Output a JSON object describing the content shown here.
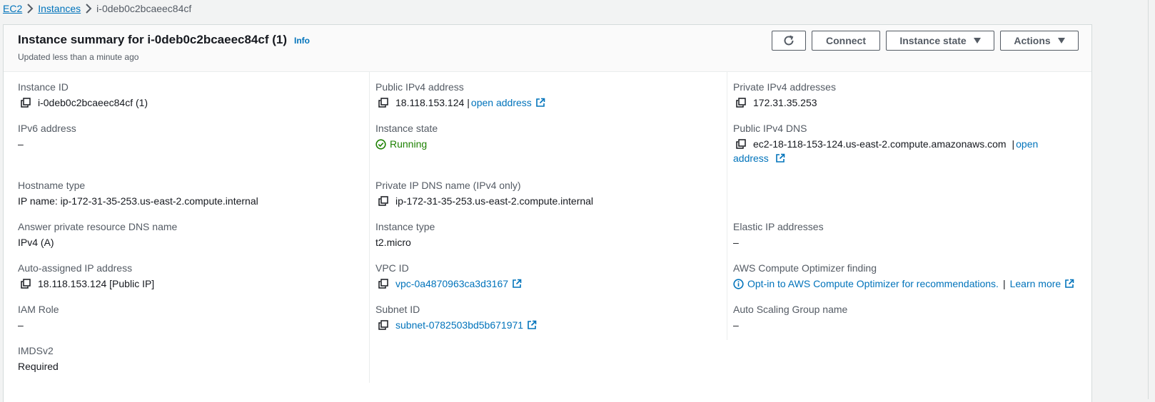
{
  "breadcrumb": {
    "root": "EC2",
    "instances": "Instances",
    "current": "i-0deb0c2bcaeec84cf"
  },
  "header": {
    "title": "Instance summary for i-0deb0c2bcaeec84cf (1)",
    "info": "Info",
    "subtitle": "Updated less than a minute ago",
    "connect": "Connect",
    "instance_state": "Instance state",
    "actions": "Actions"
  },
  "fields": {
    "instance_id": {
      "label": "Instance ID",
      "value": "i-0deb0c2bcaeec84cf (1)"
    },
    "ipv6": {
      "label": "IPv6 address",
      "value": "–"
    },
    "hostname_type": {
      "label": "Hostname type",
      "value": "IP name: ip-172-31-35-253.us-east-2.compute.internal"
    },
    "answer_dns": {
      "label": "Answer private resource DNS name",
      "value": "IPv4 (A)"
    },
    "auto_ip": {
      "label": "Auto-assigned IP address",
      "value": "18.118.153.124 [Public IP]"
    },
    "iam_role": {
      "label": "IAM Role",
      "value": "–"
    },
    "imdsv2": {
      "label": "IMDSv2",
      "value": "Required"
    },
    "public_ipv4": {
      "label": "Public IPv4 address",
      "value": "18.118.153.124",
      "bar": "|",
      "link": "open address"
    },
    "instance_state": {
      "label": "Instance state",
      "value": "Running"
    },
    "private_dns": {
      "label": "Private IP DNS name (IPv4 only)",
      "value": "ip-172-31-35-253.us-east-2.compute.internal"
    },
    "instance_type": {
      "label": "Instance type",
      "value": "t2.micro"
    },
    "vpc_id": {
      "label": "VPC ID",
      "value": "vpc-0a4870963ca3d3167"
    },
    "subnet_id": {
      "label": "Subnet ID",
      "value": "subnet-0782503bd5b671971"
    },
    "private_ipv4": {
      "label": "Private IPv4 addresses",
      "value": "172.31.35.253"
    },
    "public_dns": {
      "label": "Public IPv4 DNS",
      "value": "ec2-18-118-153-124.us-east-2.compute.amazonaws.com",
      "bar": "|",
      "link": "open address"
    },
    "elastic_ip": {
      "label": "Elastic IP addresses",
      "value": "–"
    },
    "optimizer": {
      "label": "AWS Compute Optimizer finding",
      "link": "Opt-in to AWS Compute Optimizer for recommendations.",
      "bar": "|",
      "learn": "Learn more"
    },
    "asg_name": {
      "label": "Auto Scaling Group name",
      "value": "–"
    }
  },
  "colors": {
    "link": "#0073bb",
    "running": "#1d8102",
    "label": "#545b64"
  },
  "icons": [
    "chevron-right-icon",
    "refresh-icon",
    "caret-down-icon",
    "copy-icon",
    "external-link-icon",
    "status-running-icon",
    "info-circle-icon"
  ]
}
